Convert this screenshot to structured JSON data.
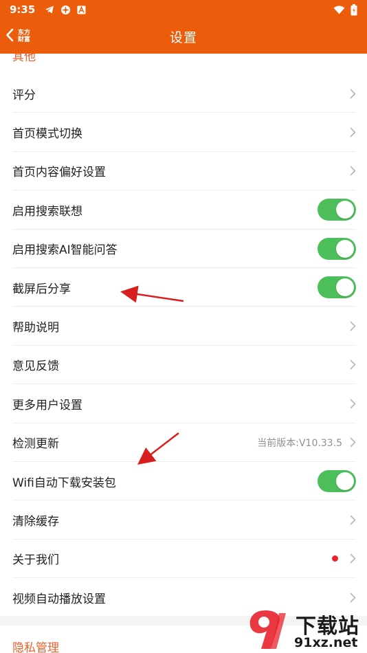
{
  "status_bar": {
    "time": "9:35",
    "icons_left": [
      "telegram-icon",
      "network-icon",
      "font-app-icon"
    ],
    "icons_right": [
      "wifi-icon",
      "battery-icon"
    ]
  },
  "header": {
    "back_icon": "chevron-left-icon",
    "logo_line1": "东方",
    "logo_line2": "财富",
    "title": "设置"
  },
  "sections": {
    "top_header": "其他",
    "bottom_header": "隐私管理"
  },
  "items": [
    {
      "label": "评分",
      "type": "chevron"
    },
    {
      "label": "首页模式切换",
      "type": "chevron"
    },
    {
      "label": "首页内容偏好设置",
      "type": "chevron"
    },
    {
      "label": "启用搜索联想",
      "type": "toggle",
      "on": true
    },
    {
      "label": "启用搜索AI智能问答",
      "type": "toggle",
      "on": true
    },
    {
      "label": "截屏后分享",
      "type": "toggle",
      "on": true
    },
    {
      "label": "帮助说明",
      "type": "chevron"
    },
    {
      "label": "意见反馈",
      "type": "chevron"
    },
    {
      "label": "更多用户设置",
      "type": "chevron"
    },
    {
      "label": "检测更新",
      "type": "chevron",
      "value": "当前版本:V10.33.5"
    },
    {
      "label": "Wifi自动下载安装包",
      "type": "toggle",
      "on": true
    },
    {
      "label": "清除缓存",
      "type": "chevron"
    },
    {
      "label": "关于我们",
      "type": "chevron",
      "badge": "red-dot"
    },
    {
      "label": "视频自动播放设置",
      "type": "chevron"
    }
  ],
  "watermark": {
    "brand": "下载站",
    "url": "91xz.net"
  },
  "colors": {
    "accent": "#ec5d0b",
    "section_header": "#e8622a",
    "toggle_on": "#4cbf5a",
    "annotation_arrow": "#d81e1e"
  }
}
